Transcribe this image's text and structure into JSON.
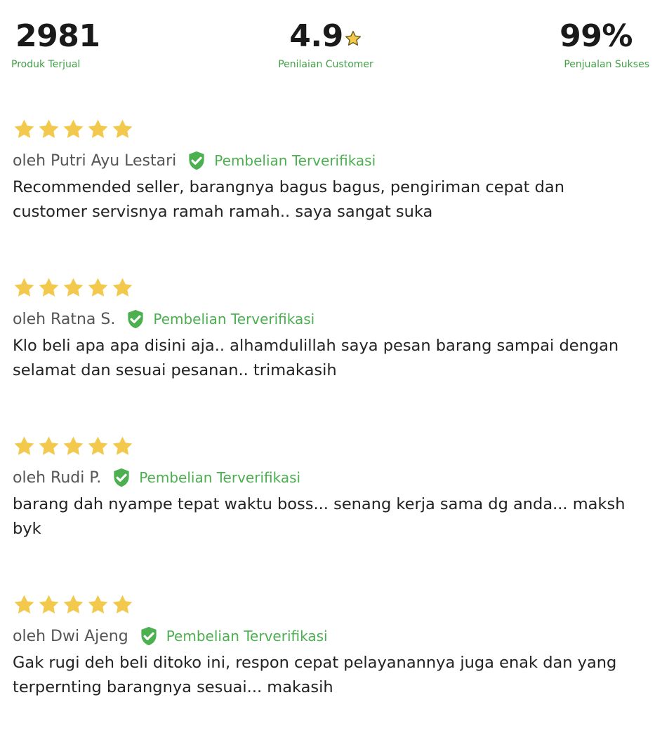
{
  "stats": [
    {
      "value": "2981",
      "label": "Produk Terjual"
    },
    {
      "value": "4.9",
      "label": "Penilaian Customer",
      "icon": "star-icon"
    },
    {
      "value": "99%",
      "label": "Penjualan Sukses"
    }
  ],
  "colors": {
    "accent_green": "#4caf50",
    "label_green": "#43a047",
    "star_gold": "#f2c94c"
  },
  "badge_icon": "verified-shield-icon",
  "reviews": [
    {
      "rating": 5,
      "author": "oleh Putri Ayu Lestari",
      "badge": "Pembelian Terverifikasi",
      "comment": "Recommended seller, barangnya bagus bagus, pengiriman cepat dan customer servisnya ramah ramah.. saya sangat suka"
    },
    {
      "rating": 5,
      "author": "oleh Ratna S.",
      "badge": "Pembelian Terverifikasi",
      "comment": "Klo beli apa apa disini aja.. alhamdulillah saya pesan barang sampai dengan selamat dan sesuai pesanan.. trimakasih"
    },
    {
      "rating": 5,
      "author": "oleh Rudi P.",
      "badge": "Pembelian Terverifikasi",
      "comment": "barang dah nyampe tepat waktu boss... senang kerja sama dg anda... maksh byk"
    },
    {
      "rating": 5,
      "author": "oleh Dwi Ajeng",
      "badge": "Pembelian Terverifikasi",
      "comment": "Gak rugi deh beli ditoko ini, respon cepat pelayanannya juga enak dan yang terpernting barangnya sesuai... makasih"
    }
  ]
}
